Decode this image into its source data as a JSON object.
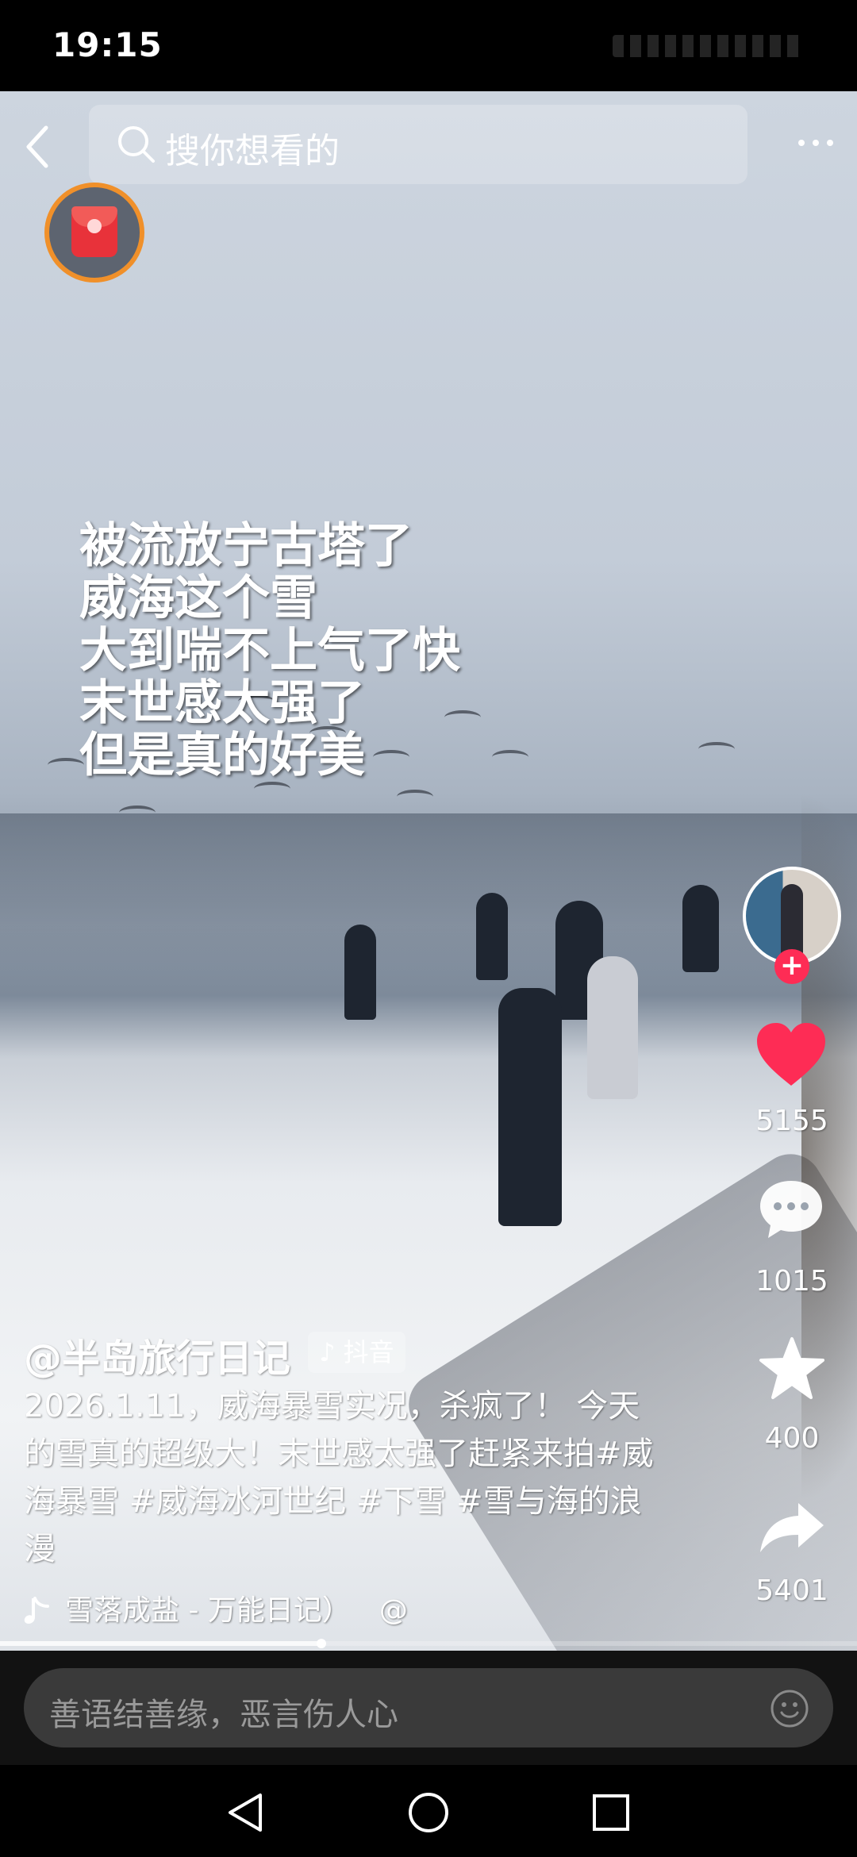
{
  "status_bar": {
    "time": "19:15"
  },
  "top_bar": {
    "search_placeholder": "搜你想看的"
  },
  "overlay_text": [
    "被流放宁古塔了",
    "威海这个雪",
    "大到喘不上气了快",
    "末世感太强了",
    "但是真的好美"
  ],
  "actions": {
    "like_count": "5155",
    "comment_count": "1015",
    "favorite_count": "400",
    "share_count": "5401",
    "like_color": "#fe2c55"
  },
  "post": {
    "author": "@半岛旅行日记",
    "badge": "抖音",
    "description": "2026.1.11，威海暴雪实况，杀疯了！ 今天的雪真的超级大！末世感太强了赶紧来拍#威海暴雪 #威海冰河世纪 #下雪 #雪与海的浪漫",
    "music": "雪落成盐 - 万能日记）",
    "music_at": "@"
  },
  "playback": {
    "progress": 0.375
  },
  "comment_bar": {
    "placeholder": "善语结善缘，恶言伤人心"
  }
}
